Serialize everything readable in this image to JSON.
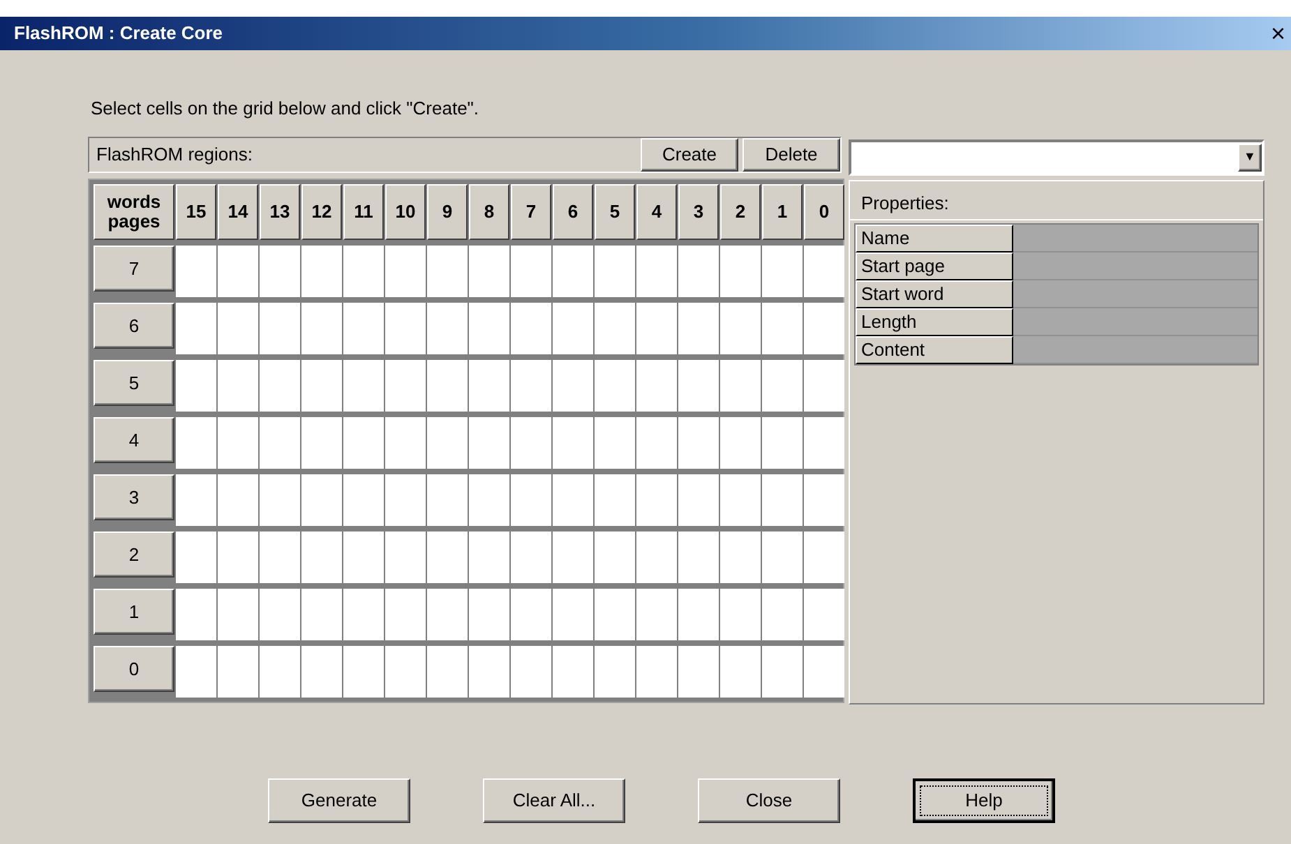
{
  "window": {
    "title": "FlashROM : Create Core",
    "close": "×"
  },
  "instruction": "Select cells on the grid below and click \"Create\".",
  "regions_bar": {
    "label": "FlashROM regions:",
    "buttons": [
      "Create",
      "Delete"
    ]
  },
  "region_select": {
    "arrow": "▼"
  },
  "grid": {
    "corner": [
      "words",
      "pages"
    ],
    "columns": [
      "15",
      "14",
      "13",
      "12",
      "11",
      "10",
      "9",
      "8",
      "7",
      "6",
      "5",
      "4",
      "3",
      "2",
      "1",
      "0"
    ],
    "pages": [
      "7",
      "6",
      "5",
      "4",
      "3",
      "2",
      "1",
      "0"
    ]
  },
  "properties": {
    "title": "Properties:",
    "rows": [
      {
        "label": "Name"
      },
      {
        "label": "Start page"
      },
      {
        "label": "Start word"
      },
      {
        "label": "Length"
      },
      {
        "label": "Content"
      }
    ]
  },
  "buttons": [
    {
      "label": "Generate",
      "default": false
    },
    {
      "label": "Clear All...",
      "default": false
    },
    {
      "label": "Close",
      "default": false
    },
    {
      "label": "Help",
      "default": true
    }
  ]
}
